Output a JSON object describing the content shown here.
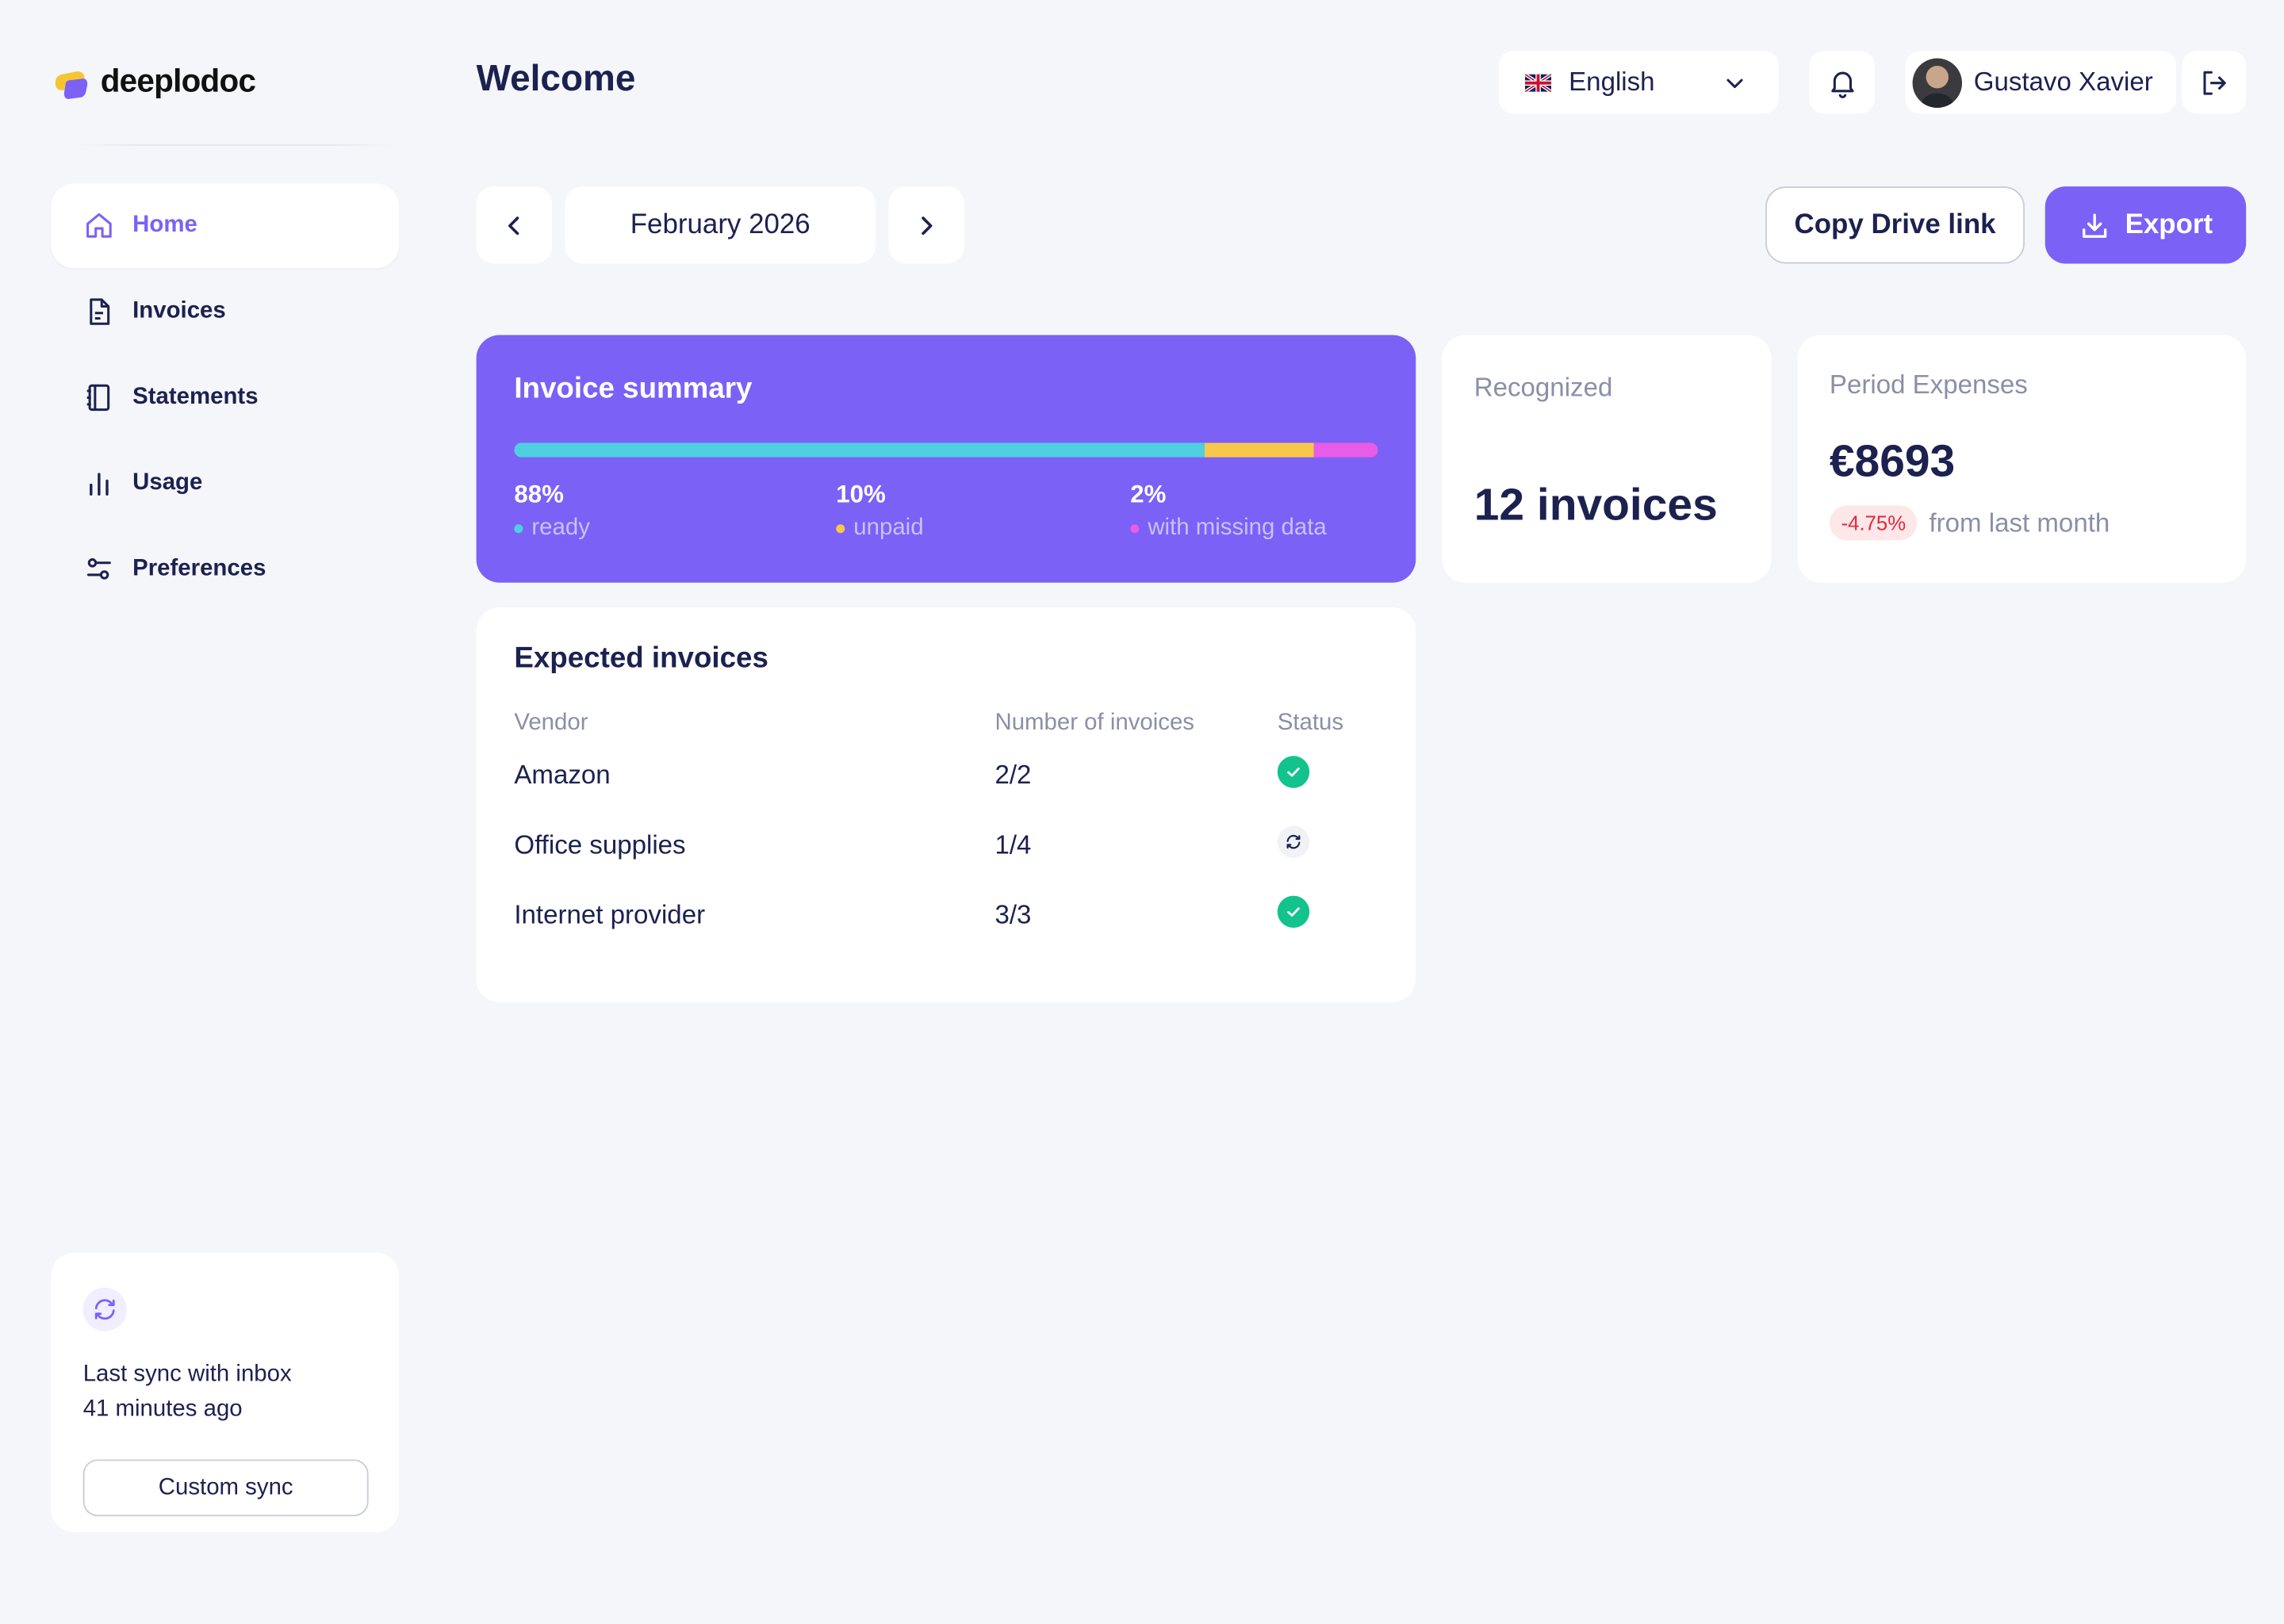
{
  "app": {
    "brand": "deeplodoc",
    "colors": {
      "accent": "#7B61F6",
      "text": "#1C2150",
      "muted": "#8A8FA8",
      "success": "#12C38E",
      "danger": "#E02A3A",
      "background": "#F5F6FA"
    }
  },
  "sidebar": {
    "items": [
      {
        "label": "Home",
        "icon": "home-icon",
        "active": true
      },
      {
        "label": "Invoices",
        "icon": "document-icon"
      },
      {
        "label": "Statements",
        "icon": "notebook-icon"
      },
      {
        "label": "Usage",
        "icon": "bar-chart-icon"
      },
      {
        "label": "Preferences",
        "icon": "sliders-icon"
      }
    ],
    "sync": {
      "line1": "Last sync with inbox",
      "line2": "41 minutes ago",
      "button_label": "Custom sync"
    }
  },
  "header": {
    "title": "Welcome",
    "language": "English",
    "language_flag": "uk-flag-icon",
    "user_name": "Gustavo Xavier"
  },
  "toolbar": {
    "period": "February 2026",
    "copy_link_label": "Copy Drive link",
    "export_label": "Export"
  },
  "summary": {
    "title": "Invoice summary",
    "segments": [
      {
        "value": "88%",
        "fraction": 0.8,
        "label": "ready",
        "color": "#4FD0E0"
      },
      {
        "value": "10%",
        "fraction": 0.125,
        "label": "unpaid",
        "color": "#F7C84A"
      },
      {
        "value": "2%",
        "fraction": 0.075,
        "label": "with missing data",
        "color": "#E85CE8"
      }
    ]
  },
  "recognized": {
    "label": "Recognized",
    "value": "12 invoices"
  },
  "expenses": {
    "label": "Period Expenses",
    "value": "€8693",
    "change": "-4.75%",
    "change_note": "from last month"
  },
  "expected": {
    "title": "Expected invoices",
    "columns": [
      "Vendor",
      "Number of invoices",
      "Status"
    ],
    "rows": [
      {
        "vendor": "Amazon",
        "count": "2/2",
        "status": "complete"
      },
      {
        "vendor": "Office supplies",
        "count": "1/4",
        "status": "pending"
      },
      {
        "vendor": "Internet provider",
        "count": "3/3",
        "status": "complete"
      }
    ]
  }
}
